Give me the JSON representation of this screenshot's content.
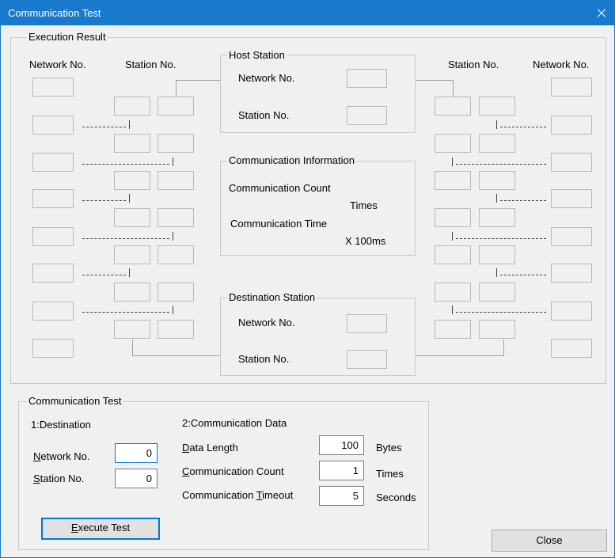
{
  "window": {
    "title": "Communication Test"
  },
  "execution": {
    "legend": "Execution Result",
    "left_network_header": "Network No.",
    "left_station_header": "Station No.",
    "right_station_header": "Station No.",
    "right_network_header": "Network No.",
    "host": {
      "legend": "Host Station",
      "network_label": "Network No.",
      "station_label": "Station No."
    },
    "info": {
      "legend": "Communication Information",
      "count_label": "Communication Count",
      "count_unit": "Times",
      "time_label": "Communication Time",
      "time_unit": "X 100ms"
    },
    "destination": {
      "legend": "Destination Station",
      "network_label": "Network No.",
      "station_label": "Station No."
    }
  },
  "comm_test": {
    "legend": "Communication Test",
    "dest_heading": "1:Destination",
    "network_label_u": "N",
    "network_label_rest": "etwork No.",
    "network_value": "0",
    "station_label_u": "S",
    "station_label_rest": "tation No.",
    "station_value": "0",
    "data_heading": "2:Communication Data",
    "data_length_u": "D",
    "data_length_rest": "ata Length",
    "data_length_value": "100",
    "data_length_unit": "Bytes",
    "count_u": "C",
    "count_rest": "ommunication Count",
    "count_value": "1",
    "count_unit": "Times",
    "timeout_pre": "Communication ",
    "timeout_u": "T",
    "timeout_rest": "imeout",
    "timeout_value": "5",
    "timeout_unit": "Seconds",
    "execute_u": "E",
    "execute_rest": "xecute Test"
  },
  "close_label": "Close"
}
